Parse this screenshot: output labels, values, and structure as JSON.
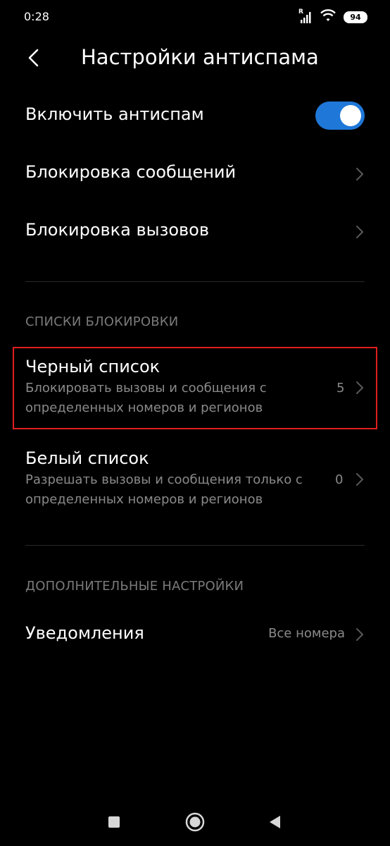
{
  "status_bar": {
    "time": "0:28",
    "signal_label": "R",
    "battery": "94"
  },
  "header": {
    "title": "Настройки антиспама"
  },
  "items": {
    "antispam": {
      "label": "Включить антиспам",
      "enabled": true
    },
    "block_messages": {
      "label": "Блокировка сообщений"
    },
    "block_calls": {
      "label": "Блокировка вызовов"
    }
  },
  "sections": {
    "block_lists": {
      "header": "СПИСКИ БЛОКИРОВКИ",
      "blacklist": {
        "title": "Черный список",
        "subtitle": "Блокировать вызовы и сообщения с определенных номеров и регионов",
        "count": "5"
      },
      "whitelist": {
        "title": "Белый список",
        "subtitle": "Разрешать вызовы и сообщения только с определенных номеров и регионов",
        "count": "0"
      }
    },
    "additional": {
      "header": "ДОПОЛНИТЕЛЬНЫЕ НАСТРОЙКИ",
      "notifications": {
        "label": "Уведомления",
        "value": "Все номера"
      }
    }
  },
  "colors": {
    "accent": "#1f78d8",
    "highlight": "#e01f1f",
    "background": "#000000"
  }
}
